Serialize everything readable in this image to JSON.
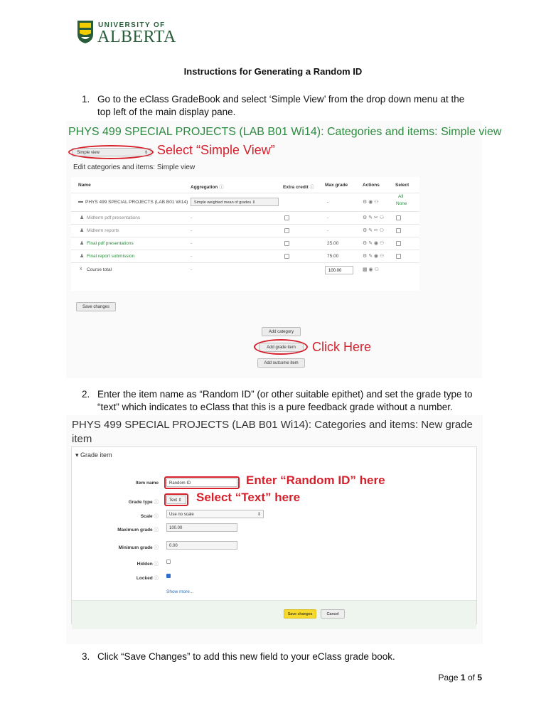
{
  "logo": {
    "line1": "UNIVERSITY OF",
    "line2": "ALBERTA",
    "brand_color": "#275d38"
  },
  "doc_title": "Instructions for Generating a Random ID",
  "steps": [
    {
      "num": "1.",
      "line1": "Go to the eClass GradeBook and select ‘Simple View’ from the drop down menu at the",
      "line2": "top left of the main display pane."
    },
    {
      "num": "2.",
      "line1": "Enter the item name as “Random ID” (or other suitable epithet) and set the grade type to",
      "line2": "“text” which indicates to eClass that this is a pure feedback grade without a number."
    },
    {
      "num": "3.",
      "line1": "Click “Save Changes” to add this new field to your eClass grade book."
    }
  ],
  "shot1": {
    "heading": "PHYS 499 SPECIAL PROJECTS (LAB B01 Wi14): Categories and items: Simple view",
    "view_select": "Simple view",
    "callout_select": "Select “Simple View”",
    "subheading": "Edit categories and items: Simple view",
    "columns": {
      "name": "Name",
      "aggregation": "Aggregation",
      "extra_credit": "Extra credit",
      "max_grade": "Max grade",
      "actions": "Actions",
      "select": "Select"
    },
    "select_all": "All",
    "select_none": "None",
    "category_row": {
      "name": "PHYS 499 SPECIAL PROJECTS (LAB B01 Wi14)",
      "aggregation": "Simple weighted mean of grades",
      "max": "-"
    },
    "rows": [
      {
        "name": "Midterm pdf presentations",
        "agg": "-",
        "max": "-"
      },
      {
        "name": "Midterm reports",
        "agg": "-",
        "max": "-"
      },
      {
        "name": "Final pdf presentations",
        "agg": "-",
        "max": "25.00"
      },
      {
        "name": "Final report submission",
        "agg": "-",
        "max": "75.00"
      }
    ],
    "total_row": {
      "name": "Course total",
      "agg": "-",
      "max": "100.00"
    },
    "save_button": "Save changes",
    "add_category": "Add category",
    "add_grade_item": "Add grade item",
    "add_outcome_item": "Add outcome item",
    "callout_click": "Click Here",
    "accent_red": "#d6202c",
    "heading_green": "#2b8a3e"
  },
  "shot2": {
    "heading": "PHYS 499 SPECIAL PROJECTS (LAB B01 Wi14): Categories and items: New grade item",
    "fieldset": "Grade item",
    "item_name_label": "Item name",
    "item_name_value": "Random ID",
    "callout_name": "Enter “Random ID” here",
    "grade_type_label": "Grade type",
    "grade_type_value": "Text",
    "callout_type": "Select “Text” here",
    "scale_label": "Scale",
    "scale_value": "Use no scale",
    "max_label": "Maximum grade",
    "max_value": "100.00",
    "min_label": "Minimum grade",
    "min_value": "0.00",
    "hidden_label": "Hidden",
    "locked_label": "Locked",
    "show_more": "Show more...",
    "save_button": "Save changes",
    "cancel_button": "Cancel"
  },
  "footer": {
    "page_prefix": "Page",
    "page_current": "1",
    "page_of": "of",
    "page_total": "5"
  }
}
